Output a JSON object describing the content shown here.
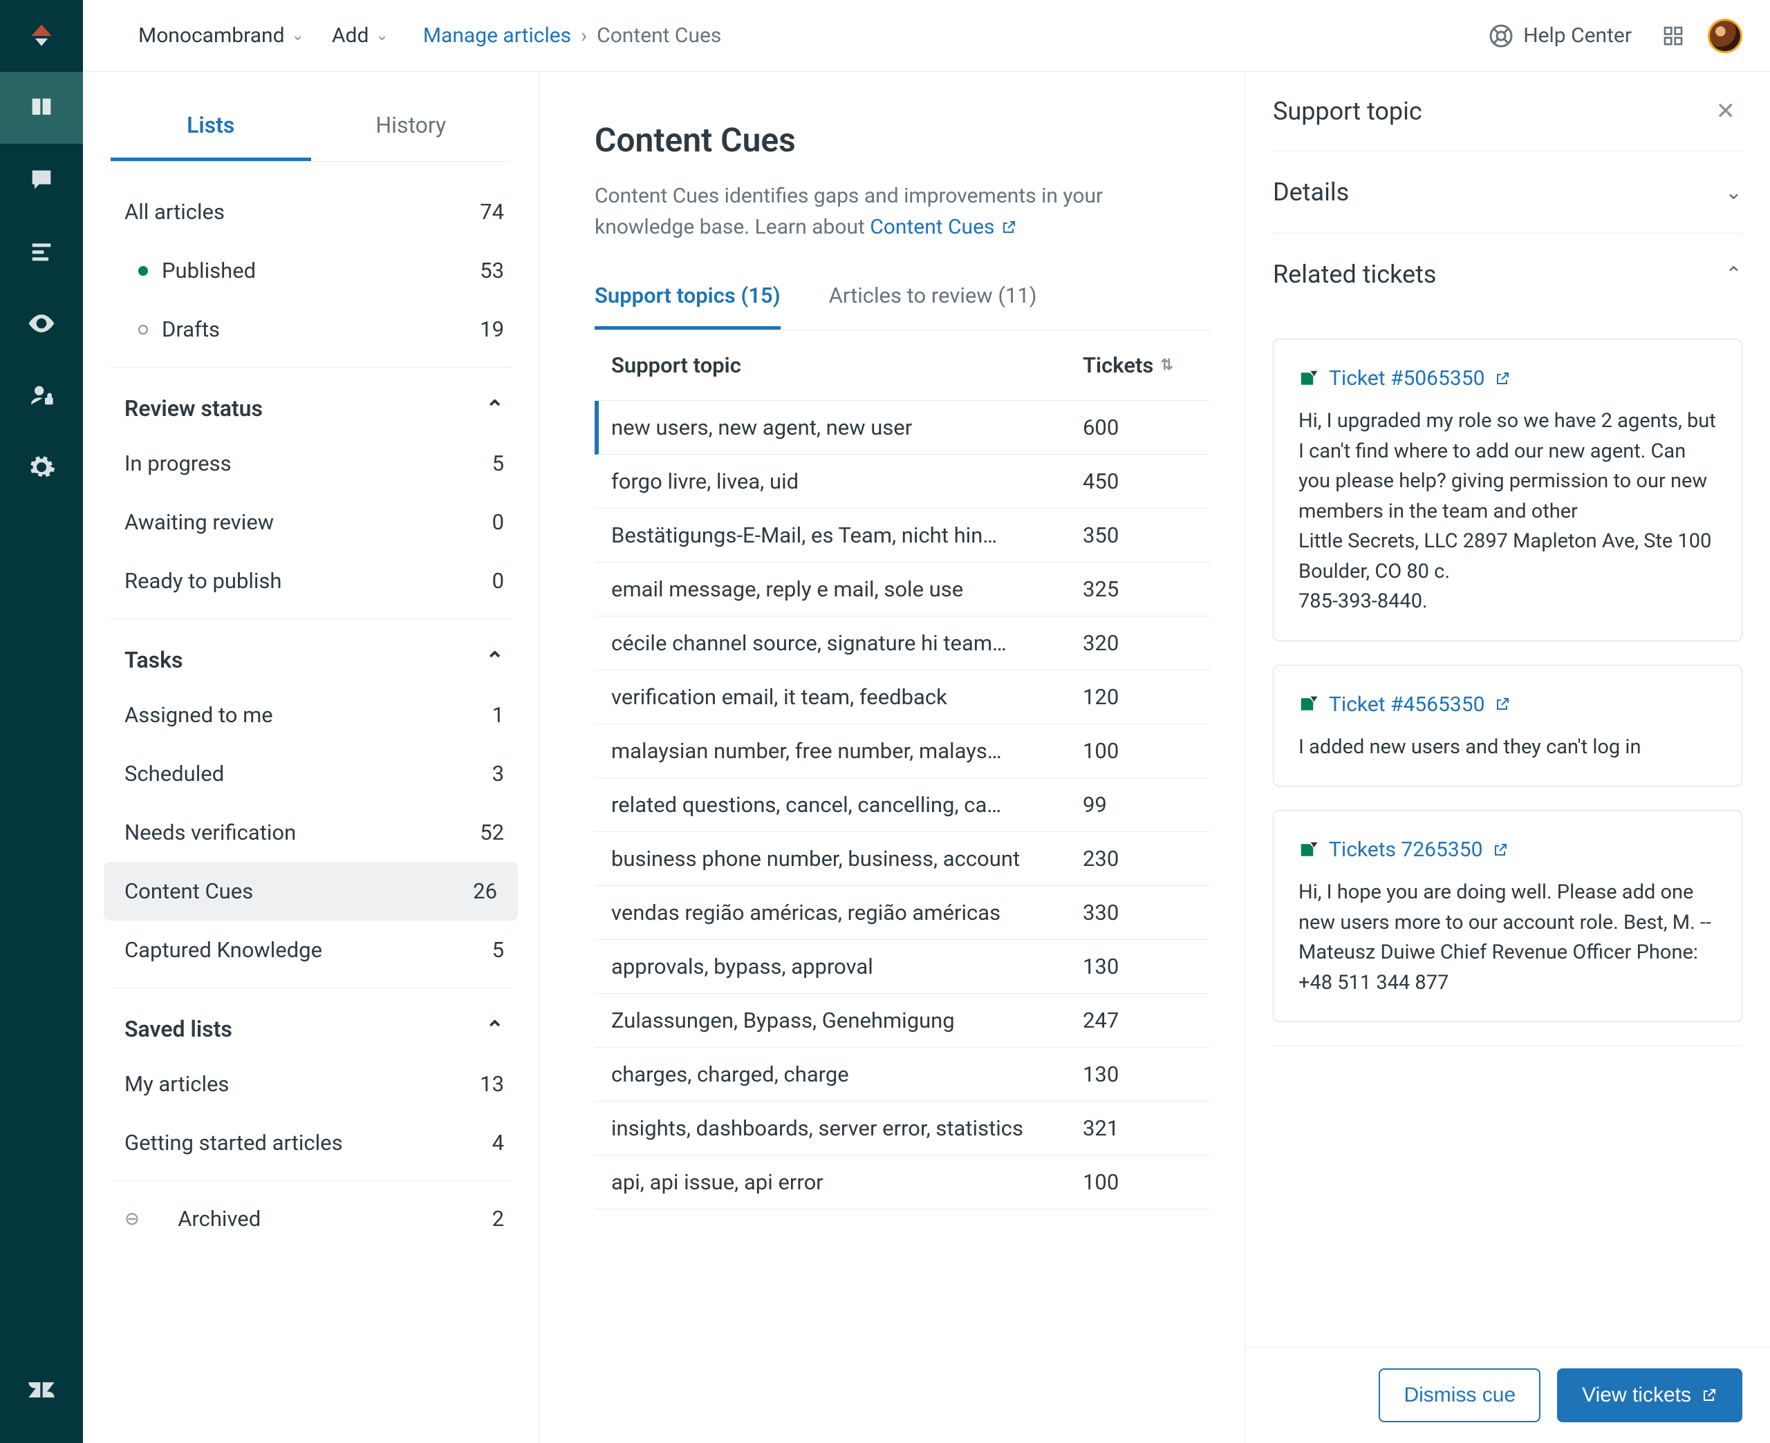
{
  "topbar": {
    "brand": "Monocambrand",
    "add": "Add",
    "crumb_link": "Manage articles",
    "crumb_current": "Content Cues",
    "help": "Help Center"
  },
  "sidebar": {
    "tab_lists": "Lists",
    "tab_history": "History",
    "all_articles": {
      "label": "All articles",
      "count": "74"
    },
    "published": {
      "label": "Published",
      "count": "53"
    },
    "drafts": {
      "label": "Drafts",
      "count": "19"
    },
    "review_section": "Review status",
    "in_progress": {
      "label": "In progress",
      "count": "5"
    },
    "awaiting": {
      "label": "Awaiting review",
      "count": "0"
    },
    "ready": {
      "label": "Ready to publish",
      "count": "0"
    },
    "tasks_section": "Tasks",
    "assigned": {
      "label": "Assigned to me",
      "count": "1"
    },
    "scheduled": {
      "label": "Scheduled",
      "count": "3"
    },
    "needs_verif": {
      "label": "Needs verification",
      "count": "52"
    },
    "content_cues": {
      "label": "Content Cues",
      "count": "26"
    },
    "captured": {
      "label": "Captured Knowledge",
      "count": "5"
    },
    "saved_section": "Saved lists",
    "my_articles": {
      "label": "My articles",
      "count": "13"
    },
    "getting_started": {
      "label": "Getting started articles",
      "count": "4"
    },
    "archived": {
      "label": "Archived",
      "count": "2"
    }
  },
  "main": {
    "title": "Content Cues",
    "desc1": "Content Cues identifies gaps and improvements in your knowledge base. Learn about ",
    "desc_link": "Content Cues",
    "tab_topics": "Support topics (15)",
    "tab_articles": "Articles to review (11)",
    "col_topic": "Support topic",
    "col_tickets": "Tickets",
    "rows": [
      {
        "topic": "new users, new agent, new user",
        "tickets": "600"
      },
      {
        "topic": "forgo livre, livea, uid",
        "tickets": "450"
      },
      {
        "topic": "Bestätigungs-E-Mail, es Team, nicht hin…",
        "tickets": "350"
      },
      {
        "topic": "email message, reply e mail, sole use",
        "tickets": "325"
      },
      {
        "topic": "cécile channel source, signature hi team…",
        "tickets": "320"
      },
      {
        "topic": "verification email, it team, feedback",
        "tickets": "120"
      },
      {
        "topic": "malaysian number, free number, malays…",
        "tickets": "100"
      },
      {
        "topic": "related questions, cancel, cancelling, ca…",
        "tickets": "99"
      },
      {
        "topic": "business phone number, business, account",
        "tickets": "230"
      },
      {
        "topic": "vendas região américas, região américas",
        "tickets": "330"
      },
      {
        "topic": "approvals, bypass, approval",
        "tickets": "130"
      },
      {
        "topic": "Zulassungen, Bypass, Genehmigung",
        "tickets": "247"
      },
      {
        "topic": "charges, charged, charge",
        "tickets": "130"
      },
      {
        "topic": "insights, dashboards, server error, statistics",
        "tickets": "321"
      },
      {
        "topic": "api, api issue, api error",
        "tickets": "100"
      }
    ]
  },
  "detail": {
    "title": "Support topic",
    "details_label": "Details",
    "related_label": "Related tickets",
    "tickets": [
      {
        "link": "Ticket #5065350",
        "body": "Hi, I upgraded my role so we have 2 agents, but I can't find where to add our new agent. Can you please help? giving permission  to our new members in the team and other\nLittle Secrets, LLC 2897 Mapleton Ave, Ste 100 Boulder, CO 80 c.\n785-393-8440."
      },
      {
        "link": "Ticket #4565350",
        "body": "I added new users and they can't log in"
      },
      {
        "link": "Tickets 7265350",
        "body": "Hi, I hope you are doing well. Please add one new users  more to our account role. Best, M. -- Mateusz Duiwe Chief Revenue Officer Phone: +48 511 344 877"
      }
    ],
    "dismiss": "Dismiss cue",
    "view": "View tickets"
  }
}
